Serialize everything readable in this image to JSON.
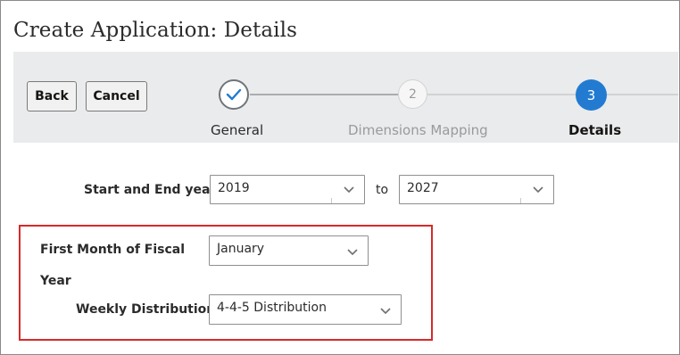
{
  "page": {
    "title": "Create Application: Details"
  },
  "toolbar": {
    "back_label": "Back",
    "cancel_label": "Cancel"
  },
  "train": {
    "steps": [
      {
        "number": "",
        "label": "General",
        "state": "completed"
      },
      {
        "number": "2",
        "label": "Dimensions Mapping",
        "state": "disabled"
      },
      {
        "number": "3",
        "label": "Details",
        "state": "current"
      }
    ],
    "accent_color": "#227bd1"
  },
  "form": {
    "start_end_year_label": "Start and End year",
    "start_year": "2019",
    "to_label": "to",
    "end_year": "2027",
    "first_month_label_line1": "First Month of Fiscal",
    "first_month_label_line2": "Year",
    "first_month_value": "January",
    "weekly_distribution_label": "Weekly Distribution",
    "weekly_distribution_value": "4-4-5 Distribution"
  },
  "annotation": {
    "highlight_color": "#d72a2a"
  }
}
